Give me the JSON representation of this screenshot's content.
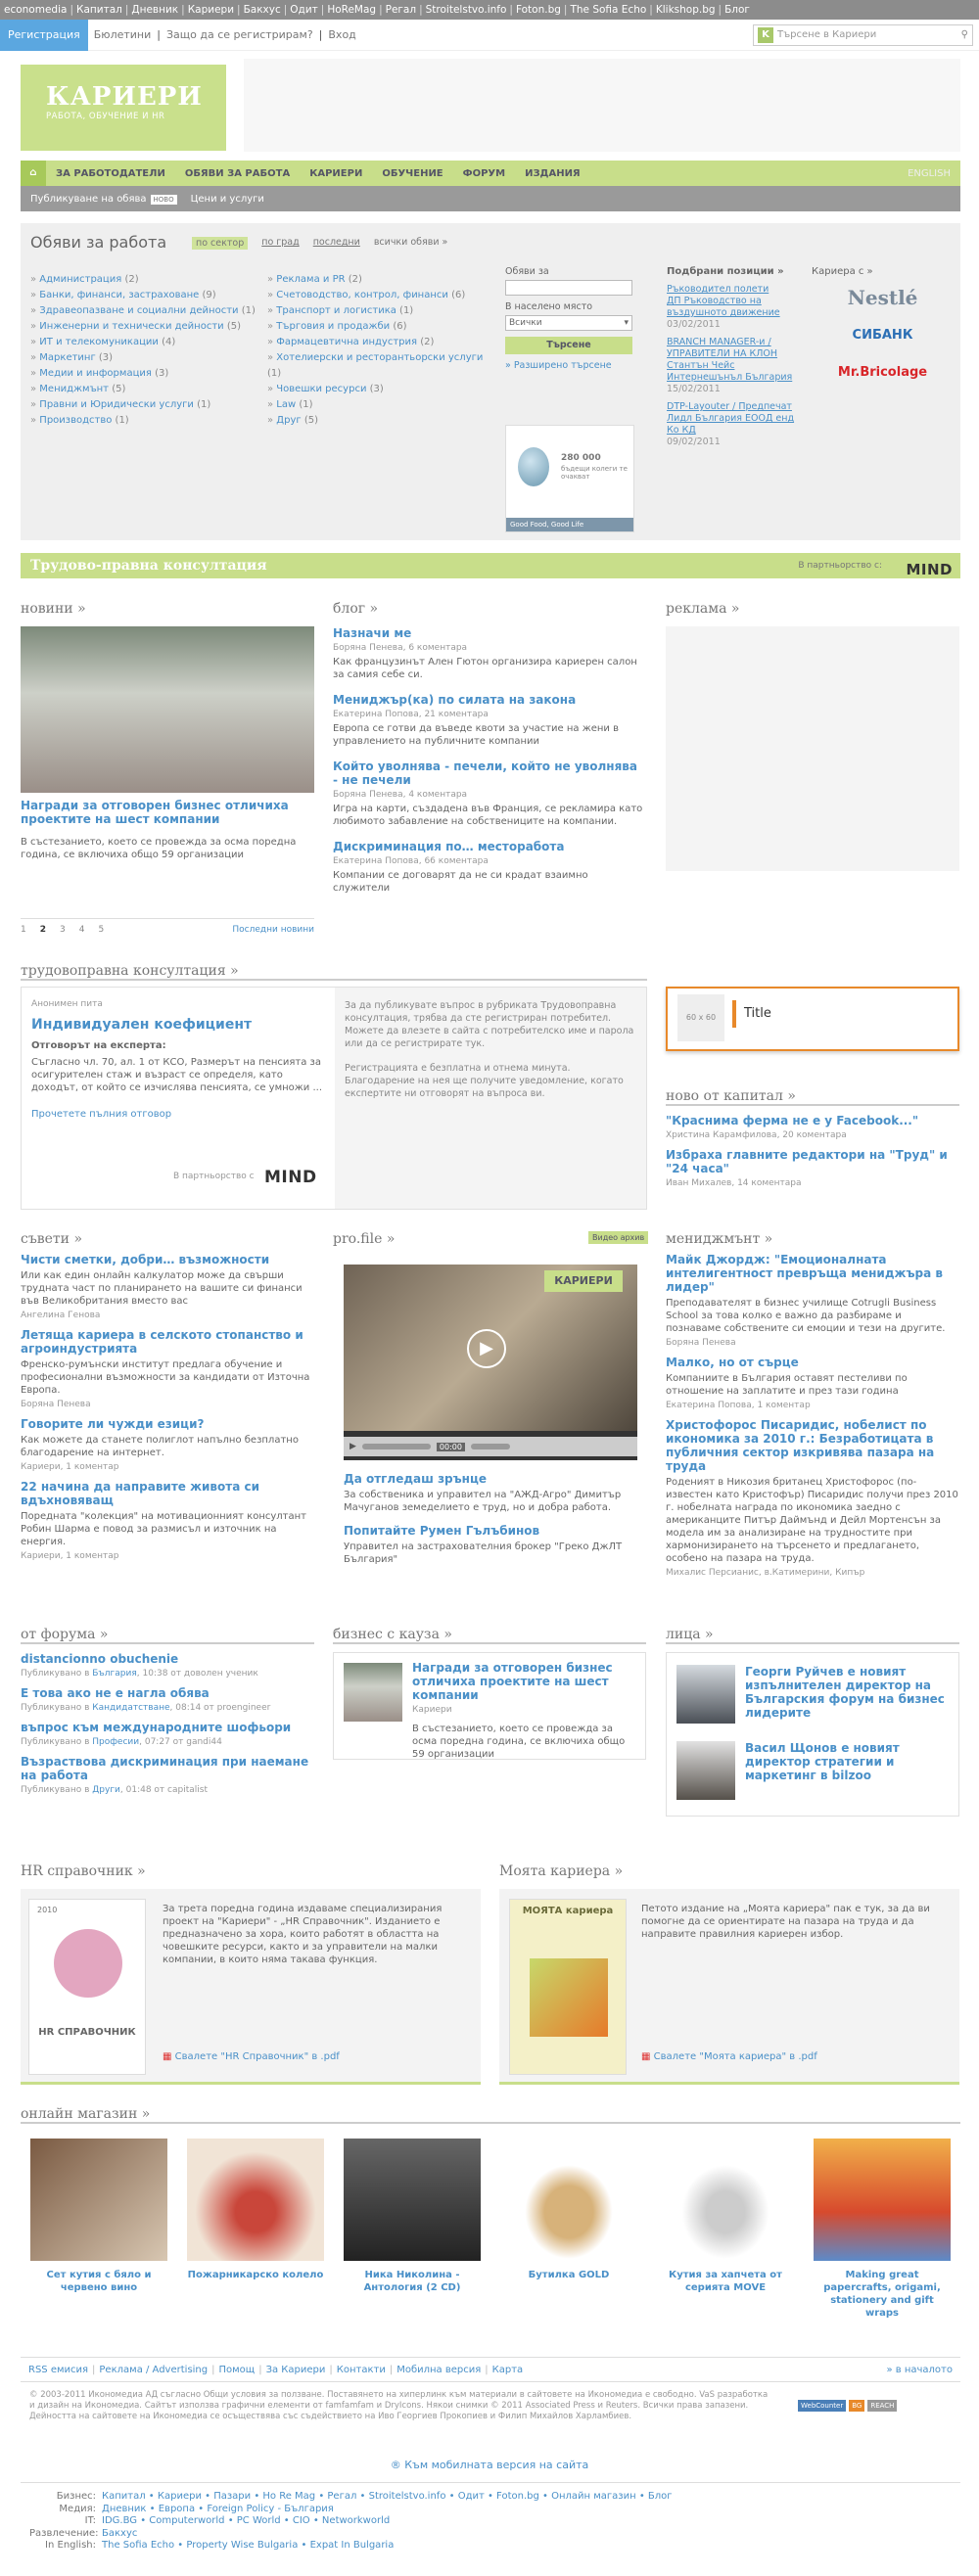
{
  "topbar": [
    "economedia",
    "Капитал",
    "Дневник",
    "Кариери",
    "Бакхус",
    "Одит",
    "HoReMag",
    "Регал",
    "Stroitelstvo.info",
    "Foton.bg",
    "The Sofia Echo",
    "Klikshop.bg",
    "Блог"
  ],
  "userbar": {
    "register": "Регистрация",
    "links": [
      "Бюлетини",
      "Защо да се регистрирам?",
      "Вход"
    ],
    "search_placeholder": "Търсене в Кариери"
  },
  "logo": {
    "title": "КАРИЕРИ",
    "subtitle": "РАБОТА, ОБУЧЕНИЕ И HR"
  },
  "nav": {
    "items": [
      "ЗА РАБОТОДАТЕЛИ",
      "ОБЯВИ ЗА РАБОТА",
      "КАРИЕРИ",
      "ОБУЧЕНИЕ",
      "ФОРУМ",
      "ИЗДАНИЯ"
    ],
    "english": "ENGLISH"
  },
  "subnav": {
    "publish": "Публикуване на обява",
    "badge": "НОВО",
    "prices": "Цени и услуги"
  },
  "jobs": {
    "title": "Обяви за работа",
    "tabs": [
      "по сектор",
      "по град",
      "последни",
      "всички обяви »"
    ],
    "cats1": [
      [
        "Администрация",
        "(2)"
      ],
      [
        "Банки, финанси, застраховане",
        "(9)"
      ],
      [
        "Здравеопазване и социални дейности",
        "(1)"
      ],
      [
        "Инженерни и технически дейности",
        "(5)"
      ],
      [
        "ИТ и телекомуникации",
        "(4)"
      ],
      [
        "Маркетинг",
        "(3)"
      ],
      [
        "Медии и информация",
        "(3)"
      ],
      [
        "Мениджмънт",
        "(5)"
      ],
      [
        "Правни и Юридически услуги",
        "(1)"
      ],
      [
        "Производство",
        "(1)"
      ]
    ],
    "cats2": [
      [
        "Реклама и PR",
        "(2)"
      ],
      [
        "Счетоводство, контрол, финанси",
        "(6)"
      ],
      [
        "Транспорт и логистика",
        "(1)"
      ],
      [
        "Търговия и продажби",
        "(6)"
      ],
      [
        "Фармацевтична индустрия",
        "(2)"
      ],
      [
        "Хотелиерски и ресторантьорски услуги",
        "(1)"
      ],
      [
        "Човешки ресурси",
        "(3)"
      ],
      [
        "Law",
        "(1)"
      ],
      [
        "Друг",
        "(5)"
      ]
    ],
    "search": {
      "label": "Обяви за",
      "city_label": "В населено място",
      "city_value": "Всички",
      "button": "Търсене",
      "advanced": "» Разширено търсене"
    },
    "nestle_ad": {
      "num": "280 000",
      "text": "бъдещи колеги те очакват",
      "brand": "Good Food, Good Life"
    },
    "featured_title": "Подбрани позиции »",
    "featured": [
      {
        "t": "Ръководител полети",
        "c": "ДП Ръководство на въздушното движение",
        "d": "03/02/2011"
      },
      {
        "t": "BRANCH MANAGER-и / УПРАВИТЕЛИ НА КЛОН",
        "c": "Стантън Чейс Интернешънъл България",
        "d": "15/02/2011"
      },
      {
        "t": "DTP-Layouter / Предпечат",
        "c": "Лидл България ЕООД енд Ко КД",
        "d": "09/02/2011"
      }
    ],
    "careers_title": "Кариера с »",
    "career_logos": [
      "Nestlé",
      "СИБАНК",
      "Mr.Bricolage"
    ]
  },
  "consult_bar": {
    "title": "Трудово-правна консултация",
    "partner": "В партньорство с:",
    "mind": "MIND"
  },
  "news": {
    "title": "новини »",
    "caption": "Награди за отговорен бизнес отличиха проектите на шест компании",
    "text": "В състезанието, което се провежда за осма поредна година, се включиха общо 59 организации",
    "pages": [
      "1",
      "2",
      "3",
      "4",
      "5"
    ],
    "last": "Последни новини"
  },
  "blog": {
    "title": "блог »",
    "items": [
      {
        "t": "Назначи ме",
        "m": "Боряна Пенева, 6 коментара",
        "d": "Как французинът Ален Гютон организира кариерен салон за самия себе си."
      },
      {
        "t": "Мениджър(ка) по силата на закона",
        "m": "Екатерина Попова, 21 коментара",
        "d": "Европа се готви да въведе квоти за участие на жени в управлението на публичните компании"
      },
      {
        "t": "Който уволнява - печели, който не уволнява - не печели",
        "m": "Боряна Пенева, 4 коментара",
        "d": "Игра на карти, създадена във Франция, се рекламира като любимото забавление на собствениците на компании."
      },
      {
        "t": "Дискриминация по… месторабота",
        "m": "Екатерина Попова, 66 коментара",
        "d": "Компании се договарят да не си крадат взаимно служители"
      }
    ]
  },
  "ads_title": "реклама »",
  "consult": {
    "title": "трудовоправна консултация »",
    "user": "Анонимен пита",
    "question": "Индивидуален коефициент",
    "answer_label": "Отговорът на експерта:",
    "answer": "Съгласно чл. 70, ал. 1 от КСО, Размерът на пенсията за осигурителен стаж и възраст се определя, като доходът, от който се изчислява пенсията, се умножи ...",
    "more": "Прочетете пълния отговор",
    "partner": "В партньорство с",
    "info1": "За да публикувате въпрос в рубриката Трудовоправна консултация, трябва да сте регистриран потребител. Можете да влезете в сайта с потребителско име и парола или да се регистрирате тук.",
    "info2": "Регистрацията е безплатна и отнема минута. Благодарение на нея ще получите уведомление, когато експертите ни отговорят на въпроса ви."
  },
  "adbox": {
    "size": "60 x 60",
    "title": "Title"
  },
  "capital": {
    "title": "ново от капитал »",
    "items": [
      {
        "t": "\"Краснима ферма не е у Facebook...\"",
        "m": "Христина Карамфилова, 20 коментара"
      },
      {
        "t": "Избраха главните редактори на \"Труд\" и \"24 часа\"",
        "m": "Иван Михалев, 14 коментара"
      }
    ]
  },
  "advice": {
    "title": "съвети »",
    "items": [
      {
        "t": "Чисти сметки, добри… възможности",
        "d": "Или как един онлайн калкулатор може да свърши трудната част по планирането на вашите си финанси във Великобритания вместо вас",
        "a": "Ангелина Генова"
      },
      {
        "t": "Летяща кариера в селското стопанство и агроиндустрията",
        "d": "Френско-румънски институт предлага обучение и професионални възможности за кандидати от Източна Европа.",
        "a": "Боряна Пенева"
      },
      {
        "t": "Говорите ли чужди езици?",
        "d": "Как можете да станете полиглот напълно безплатно благодарение на интернет.",
        "a": "Кариери, 1 коментар"
      },
      {
        "t": "22 начина да направите живота си вдъхновяващ",
        "d": "Поредната \"колекция\" на мотивационният консултант Робин Шарма е повод за размисъл и източник на енергия.",
        "a": "Кариери, 1 коментар"
      }
    ]
  },
  "profile": {
    "title": "pro.file »",
    "badge": "Видео архив",
    "video_brand": "КАРИЕРИ",
    "time": "00:00",
    "items": [
      {
        "t": "Да отгледаш зрънце",
        "d": "За собственика и управител на \"АЖД-Агро\" Димитър Мачуганов земеделието е труд, но и добра работа."
      },
      {
        "t": "Попитайте Румен Гълъбинов",
        "d": "Управител на застрахователния брокер \"Греко ДжЛТ България\""
      }
    ]
  },
  "management": {
    "title": "мениджмънт »",
    "items": [
      {
        "t": "Майк Джордж: \"Емоционалната интелигентност превръща мениджъра в лидер\"",
        "d": "Преподавателят в бизнес училище Cotrugli Business School за това колко е важно да разбираме и познаваме собствените си емоции и тези на другите.",
        "a": "Боряна Пенева"
      },
      {
        "t": "Малко, но от сърце",
        "d": "Компаниите в България оставят пестеливи по отношение на заплатите и през тази година",
        "a": "Екатерина Попова, 1 коментар"
      },
      {
        "t": "Христофорос Писаридис, нобелист по икономика за 2010 г.: Безработицата в публичния сектор изкривява пазара на труда",
        "d": "Роденият в Никозия британец Христофорос (по-известен като Кристофър) Писаридис получи през 2010 г. нобелната награда по икономика заедно с американците Питър Даймънд и Дейл Мортенсън за модела им за анализиране на трудностите при хармонизирането на търсенето и предлагането, особено на пазара на труда.",
        "a": "Михалис Персианис, в.Катимерини, Кипър"
      }
    ]
  },
  "forum": {
    "title": "от форума »",
    "items": [
      {
        "t": "distancionno obuchenie",
        "m1": "Публикувано в ",
        "cat": "България",
        "m2": ", 10:38 от доволен ученик"
      },
      {
        "t": "Е това ако не е нагла обява",
        "m1": "Публикувано в ",
        "cat": "Кандидатстване",
        "m2": ", 08:14 от proengineer"
      },
      {
        "t": "въпрос към международните шофьори",
        "m1": "Публикувано в ",
        "cat": "Професии",
        "m2": ", 07:27 от gandi44"
      },
      {
        "t": "Възраствова дискриминация при наемане на работа",
        "m1": "Публикувано в ",
        "cat": "Други",
        "m2": ", 01:48 от capitalist"
      }
    ]
  },
  "cause": {
    "title": "бизнес с кауза »",
    "t": "Награди за отговорен бизнес отличиха проектите на шест компании",
    "a": "Кариери",
    "d": "В състезанието, което се провежда за осма поредна година, се включиха общо 59 организации"
  },
  "faces": {
    "title": "лица »",
    "items": [
      {
        "t": "Георги Руйчев е новият изпълнителен директор на Българския форум на бизнес лидерите"
      },
      {
        "t": "Васил Щонов е новият директор стратегии и маркетинг в bilzoo"
      }
    ]
  },
  "hr": {
    "title": "HR справочник »",
    "text": "За трета поредна година издаваме специализирания проект на \"Кариери\" - „HR Справочник\". Изданието е предназначено за хора, които работят в областта на човешките ресурси, както и за управители на малки компании, в които няма такава функция.",
    "download": "Свалете \"HR Справочник\" в .pdf",
    "year": "2010",
    "cover": "HR СПРАВОЧНИК"
  },
  "mycareer": {
    "title": "Моята кариера »",
    "text": "Петото издание на „Моята кариера\" пак е тук, за да ви помогне да се ориентирате на пазара на труда и да направите правилния кариерен избор.",
    "download": "Свалете \"Моята кариера\" в .pdf",
    "cover": "МОЯТА кариера"
  },
  "shop": {
    "title": "онлайн магазин »",
    "items": [
      "Сет кутия с бяло и червено вино",
      "Пожарникарско колело",
      "Ника Николина - Антология (2 CD)",
      "Бутилка GOLD",
      "Кутия за хапчета от серията MOVE",
      "Making great papercrafts, origami, stationery and gift wraps"
    ]
  },
  "footer": {
    "links": [
      "RSS емисия",
      "Реклама / Advertising",
      "Помощ",
      "За Кариери",
      "Контакти",
      "Мобилна версия",
      "Карта"
    ],
    "top": "» в началото",
    "copy": "© 2003-2011 Икономедиа АД съгласно Общи условия за ползване. Поставянето на хиперлинк към материали в сайтовете на Икономедиа е свободно. VaS разработка и дизайн на Икономедиа. Сайтът използва графични елементи от famfamfam и DryIcons. Някои снимки © 2011 Associated Press и Reuters. Всички права запазени. Дейността на сайтовете на Икономедиа се осъществява със съдействието на Иво Георгиев Прокопиев и Филип Михайлов Харламбиев.",
    "counters": [
      "WebCounter",
      "BG",
      "REACH"
    ],
    "mobile": "® Към мобилната версия на сайта",
    "groups": [
      {
        "k": "Бизнес:",
        "v": "Капитал • Кариери • Пазари • Ho Re Mag • Регал • Stroitelstvo.info • Одит • Foton.bg • Онлайн магазин • Блог"
      },
      {
        "k": "Медия:",
        "v": "Дневник • Европа • Foreign Policy - България"
      },
      {
        "k": "IT:",
        "v": "IDG.BG • Computerworld • PC World • CIO • Networkworld"
      },
      {
        "k": "Развлечение:",
        "v": "Бакхус"
      },
      {
        "k": "In English:",
        "v": "The Sofia Echo • Property Wise Bulgaria • Expat In Bulgaria"
      }
    ]
  },
  "colors": {
    "green": "#c8de8a",
    "blue": "#4a90c8",
    "orange": "#e8892a",
    "gray": "#8c8c8c"
  }
}
